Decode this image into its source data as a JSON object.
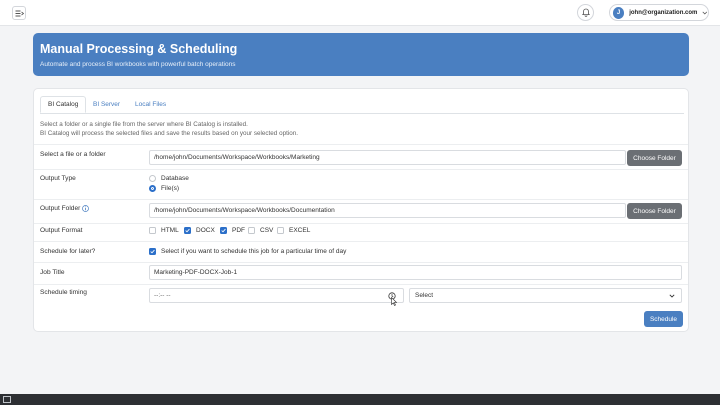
{
  "header": {
    "user_initial": "J",
    "user_email": "john@organization.com"
  },
  "banner": {
    "title": "Manual Processing & Scheduling",
    "subtitle": "Automate and process BI workbooks with powerful batch operations",
    "color": "#4a7fc1"
  },
  "tabs": [
    {
      "label": "BI Catalog",
      "active": true
    },
    {
      "label": "BI Server",
      "active": false
    },
    {
      "label": "Local Files",
      "active": false
    }
  ],
  "description": {
    "line1": "Select a folder or a single file from the server where BI Catalog is installed.",
    "line2": "BI Catalog will process the selected files and save the results based on your selected option."
  },
  "form": {
    "source": {
      "label": "Select a file or a folder",
      "value": "/home/john/Documents/Workspace/Workbooks/Marketing",
      "button": "Choose Folder"
    },
    "output_type": {
      "label": "Output Type",
      "options": [
        {
          "label": "Database",
          "selected": false
        },
        {
          "label": "File(s)",
          "selected": true
        }
      ]
    },
    "output_folder": {
      "label": "Output Folder",
      "value": "/home/john/Documents/Workspace/Workbooks/Documentation",
      "button": "Choose Folder"
    },
    "output_format": {
      "label": "Output Format",
      "options": [
        {
          "label": "HTML",
          "checked": false
        },
        {
          "label": "DOCX",
          "checked": true
        },
        {
          "label": "PDF",
          "checked": true
        },
        {
          "label": "CSV",
          "checked": false
        },
        {
          "label": "EXCEL",
          "checked": false
        }
      ]
    },
    "schedule_later": {
      "label": "Schedule for later?",
      "checkbox_text": "Select if you want to schedule this job for a particular time of day",
      "checked": true
    },
    "job_title": {
      "label": "Job Title",
      "value": "Marketing-PDF-DOCX-Job-1"
    },
    "schedule_timing": {
      "label": "Schedule timing",
      "time_placeholder": "--:-- --",
      "select_value": "Select"
    },
    "submit": "Schedule"
  }
}
